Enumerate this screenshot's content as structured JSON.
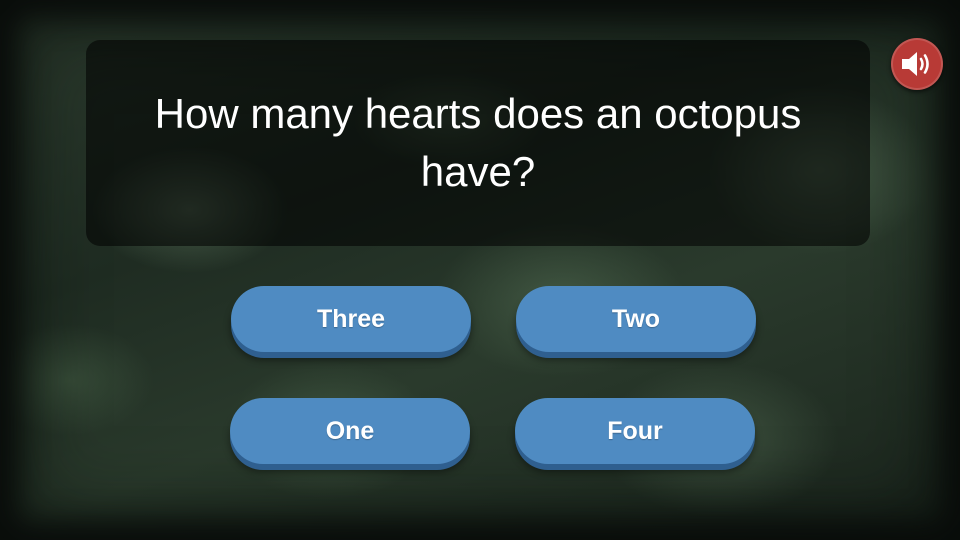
{
  "question": {
    "text": "How many hearts does an octopus have?"
  },
  "answers": [
    {
      "label": "Three"
    },
    {
      "label": "Two"
    },
    {
      "label": "One"
    },
    {
      "label": "Four"
    }
  ],
  "sound_button": {
    "icon": "speaker-volume-icon"
  },
  "colors": {
    "answer_button": "#4f8bc2",
    "answer_button_shadow": "#2f5f8f",
    "sound_button": "#b83a36"
  }
}
